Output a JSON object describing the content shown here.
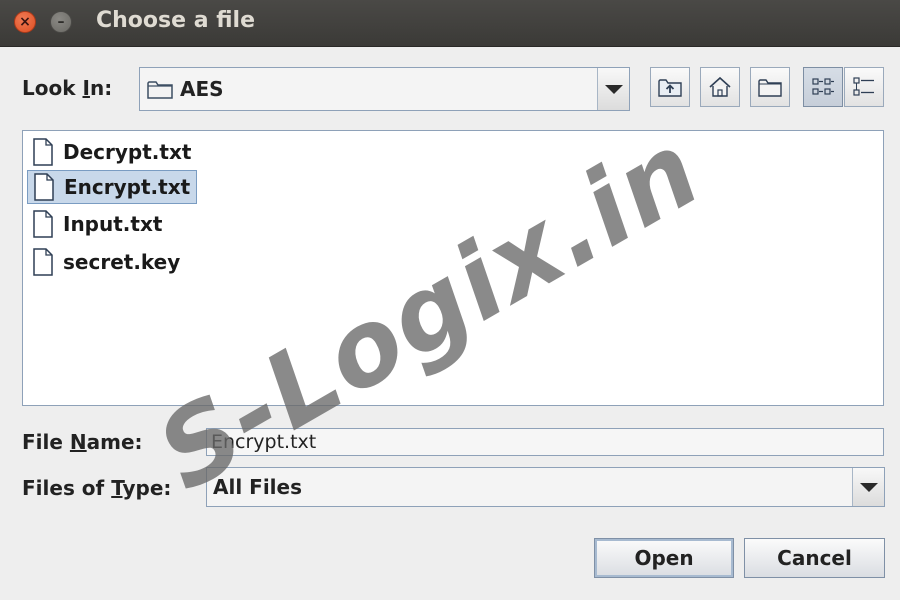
{
  "window": {
    "title": "Choose a file",
    "close_glyph": "×",
    "minimize_glyph": "–"
  },
  "look_in": {
    "label_prefix": "Look ",
    "label_mnemonic": "I",
    "label_suffix": "n:",
    "value": "AES",
    "icon": "folder-icon"
  },
  "toolbar": {
    "buttons": [
      "up-one-level-icon",
      "home-icon",
      "new-folder-icon",
      "list-view-icon",
      "details-view-icon"
    ],
    "pressed": "list-view-icon"
  },
  "files": [
    {
      "name": "Decrypt.txt",
      "icon": "file-icon",
      "selected": false
    },
    {
      "name": "Encrypt.txt",
      "icon": "file-icon",
      "selected": true
    },
    {
      "name": "Input.txt",
      "icon": "file-icon",
      "selected": false
    },
    {
      "name": "secret.key",
      "icon": "file-icon",
      "selected": false
    }
  ],
  "file_name": {
    "label_prefix": "File ",
    "label_mnemonic": "N",
    "label_suffix": "ame:",
    "value": "Encrypt.txt"
  },
  "files_of_type": {
    "label_prefix": "Files of ",
    "label_mnemonic": "T",
    "label_suffix": "ype:",
    "value": "All Files"
  },
  "actions": {
    "open_label": "Open",
    "cancel_label": "Cancel"
  },
  "watermark": "S-Logix.in",
  "colors": {
    "titlebar": "#3d3c39",
    "close_button": "#e25a2c",
    "dialog_bg": "#eeeeee",
    "selection_bg": "#c8d8ea",
    "border": "#8ea1b8"
  }
}
